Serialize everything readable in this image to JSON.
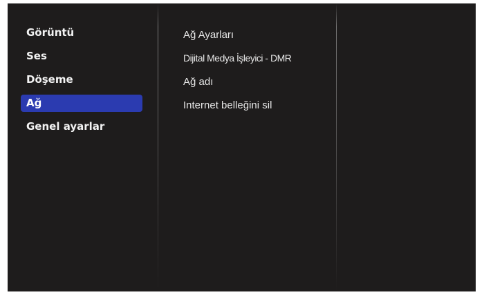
{
  "main_menu": {
    "items": [
      {
        "label": "Görüntü"
      },
      {
        "label": "Ses"
      },
      {
        "label": "Döşeme"
      },
      {
        "label": "Ağ"
      },
      {
        "label": "Genel ayarlar"
      }
    ],
    "selected_index": 3
  },
  "network_menu": {
    "items": [
      {
        "label": "Ağ Ayarları"
      },
      {
        "label": "Dijital Medya İşleyici - DMR"
      },
      {
        "label": "Ağ adı"
      },
      {
        "label": "Internet belleğini sil"
      }
    ]
  },
  "colors": {
    "background": "#1e1c1c",
    "highlight": "#2b3bb0",
    "text": "#f2f2f2"
  }
}
